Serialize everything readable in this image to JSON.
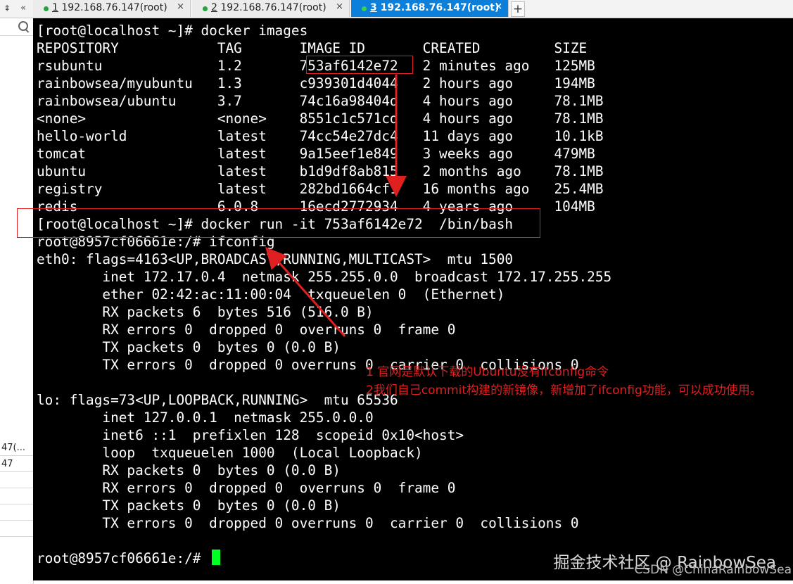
{
  "tabs": [
    {
      "number": "1",
      "title": "192.168.76.147(root)",
      "active": false
    },
    {
      "number": "2",
      "title": "192.168.76.147(root)",
      "active": false
    },
    {
      "number": "3",
      "title": "192.168.76.147(root)",
      "active": true
    }
  ],
  "tab_close_glyph": "×",
  "add_tab_glyph": "+",
  "pin_glyph": "⇞",
  "chevron_glyph": "«",
  "sidebar": {
    "rows": [
      "47(...",
      "47"
    ]
  },
  "terminal": {
    "lines": [
      "[root@localhost ~]# docker images",
      "REPOSITORY            TAG       IMAGE ID       CREATED         SIZE",
      "rsubuntu              1.2       753af6142e72   2 minutes ago   125MB",
      "rainbowsea/myubuntu   1.3       c939301d4044   2 hours ago     194MB",
      "rainbowsea/ubuntu     3.7       74c16a98404d   4 hours ago     78.1MB",
      "<none>                <none>    8551c1c571cd   4 hours ago     78.1MB",
      "hello-world           latest    74cc54e27dc4   11 days ago     10.1kB",
      "tomcat                latest    9a15eef1e849   3 weeks ago     479MB",
      "ubuntu                latest    b1d9df8ab815   2 months ago    78.1MB",
      "registry              latest    282bd1664cf1   16 months ago   25.4MB",
      "redis                 6.0.8     16ecd2772934   4 years ago     104MB",
      "[root@localhost ~]# docker run -it 753af6142e72  /bin/bash",
      "root@8957cf06661e:/# ifconfig",
      "eth0: flags=4163<UP,BROADCAST,RUNNING,MULTICAST>  mtu 1500",
      "        inet 172.17.0.4  netmask 255.255.0.0  broadcast 172.17.255.255",
      "        ether 02:42:ac:11:00:04  txqueuelen 0  (Ethernet)",
      "        RX packets 6  bytes 516 (516.0 B)",
      "        RX errors 0  dropped 0  overruns 0  frame 0",
      "        TX packets 0  bytes 0 (0.0 B)",
      "        TX errors 0  dropped 0 overruns 0  carrier 0  collisions 0",
      "",
      "lo: flags=73<UP,LOOPBACK,RUNNING>  mtu 65536",
      "        inet 127.0.0.1  netmask 255.0.0.0",
      "        inet6 ::1  prefixlen 128  scopeid 0x10<host>",
      "        loop  txqueuelen 1000  (Local Loopback)",
      "        RX packets 0  bytes 0 (0.0 B)",
      "        RX errors 0  dropped 0  overruns 0  frame 0",
      "        TX packets 0  bytes 0 (0.0 B)",
      "        TX errors 0  dropped 0 overruns 0  carrier 0  collisions 0",
      "",
      "root@8957cf06661e:/# "
    ]
  },
  "annotations": {
    "note1": "1 官网是默认下载的Ubuntu没有ifconfig命令",
    "note2": "2我们自己commit构建的新镜像，新增加了ifconfig功能，可以成功使用。",
    "color": "#e02020"
  },
  "watermark": {
    "line1": "掘金技术社区 @ RainbowSea",
    "line2": "CSDN @ChinaRainbowSea"
  },
  "colors": {
    "tab_active": "#0b7fd9",
    "status_dot": "#1fa53a",
    "terminal_bg": "#000000",
    "terminal_fg": "#ffffff",
    "cursor": "#00ff22"
  }
}
